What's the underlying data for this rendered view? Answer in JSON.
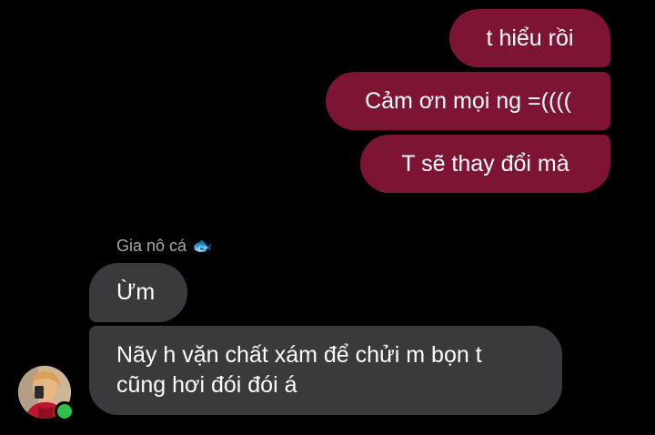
{
  "conversation": {
    "sent": [
      {
        "text": "t hiểu rồi"
      },
      {
        "text": "Cảm ơn mọi ng =(((("
      },
      {
        "text": "T sẽ thay đổi mà"
      }
    ],
    "sender": {
      "name": "Gia nô cá",
      "emoji": "🐟"
    },
    "received": [
      {
        "text": "Ừm"
      },
      {
        "line1": "Nãy h vặn chất xám để chửi m bọn t",
        "line2": "cũng hơi đói đói á"
      }
    ]
  },
  "avatar": {
    "icon": "profile-photo",
    "status": "online"
  },
  "colors": {
    "sent_bubble": "#7d1434",
    "received_bubble": "#3a3a3c",
    "background": "#000000",
    "online_dot": "#2fbf4a"
  }
}
